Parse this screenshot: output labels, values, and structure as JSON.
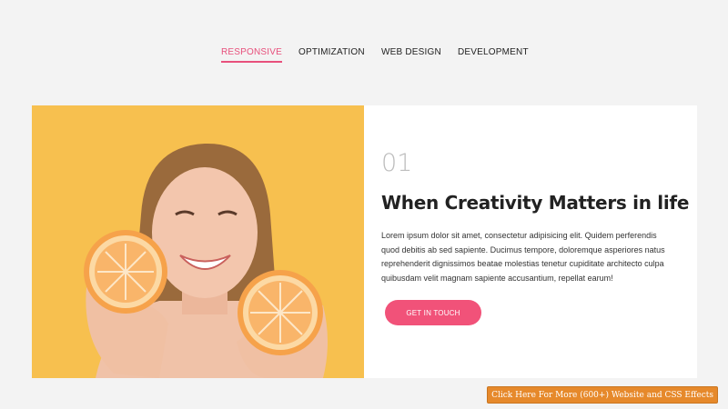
{
  "nav": {
    "tabs": [
      {
        "label": "RESPONSIVE",
        "active": true
      },
      {
        "label": "OPTIMIZATION",
        "active": false
      },
      {
        "label": "WEB DESIGN",
        "active": false
      },
      {
        "label": "DEVELOPMENT",
        "active": false
      }
    ]
  },
  "feature": {
    "number": "01",
    "title": "When Creativity Matters in life",
    "description": "Lorem ipsum dolor sit amet, consectetur adipisicing elit. Quidem perferendis quod debitis ab sed sapiente. Ducimus tempore, doloremque asperiores natus reprehenderit dignissimos beatae molestias tenetur cupiditate architecto culpa quibusdam velit magnam sapiente accusantium, repellat earum!",
    "cta_label": "GET IN TOUCH",
    "image_alt": "woman-holding-grapefruit-photo"
  },
  "promo": {
    "label": "Click Here For More (600+) Website and CSS Effects"
  },
  "colors": {
    "accent": "#e8507c",
    "button": "#f15279",
    "photo_bg": "#f7c04f",
    "promo_bg": "#e6892b"
  }
}
